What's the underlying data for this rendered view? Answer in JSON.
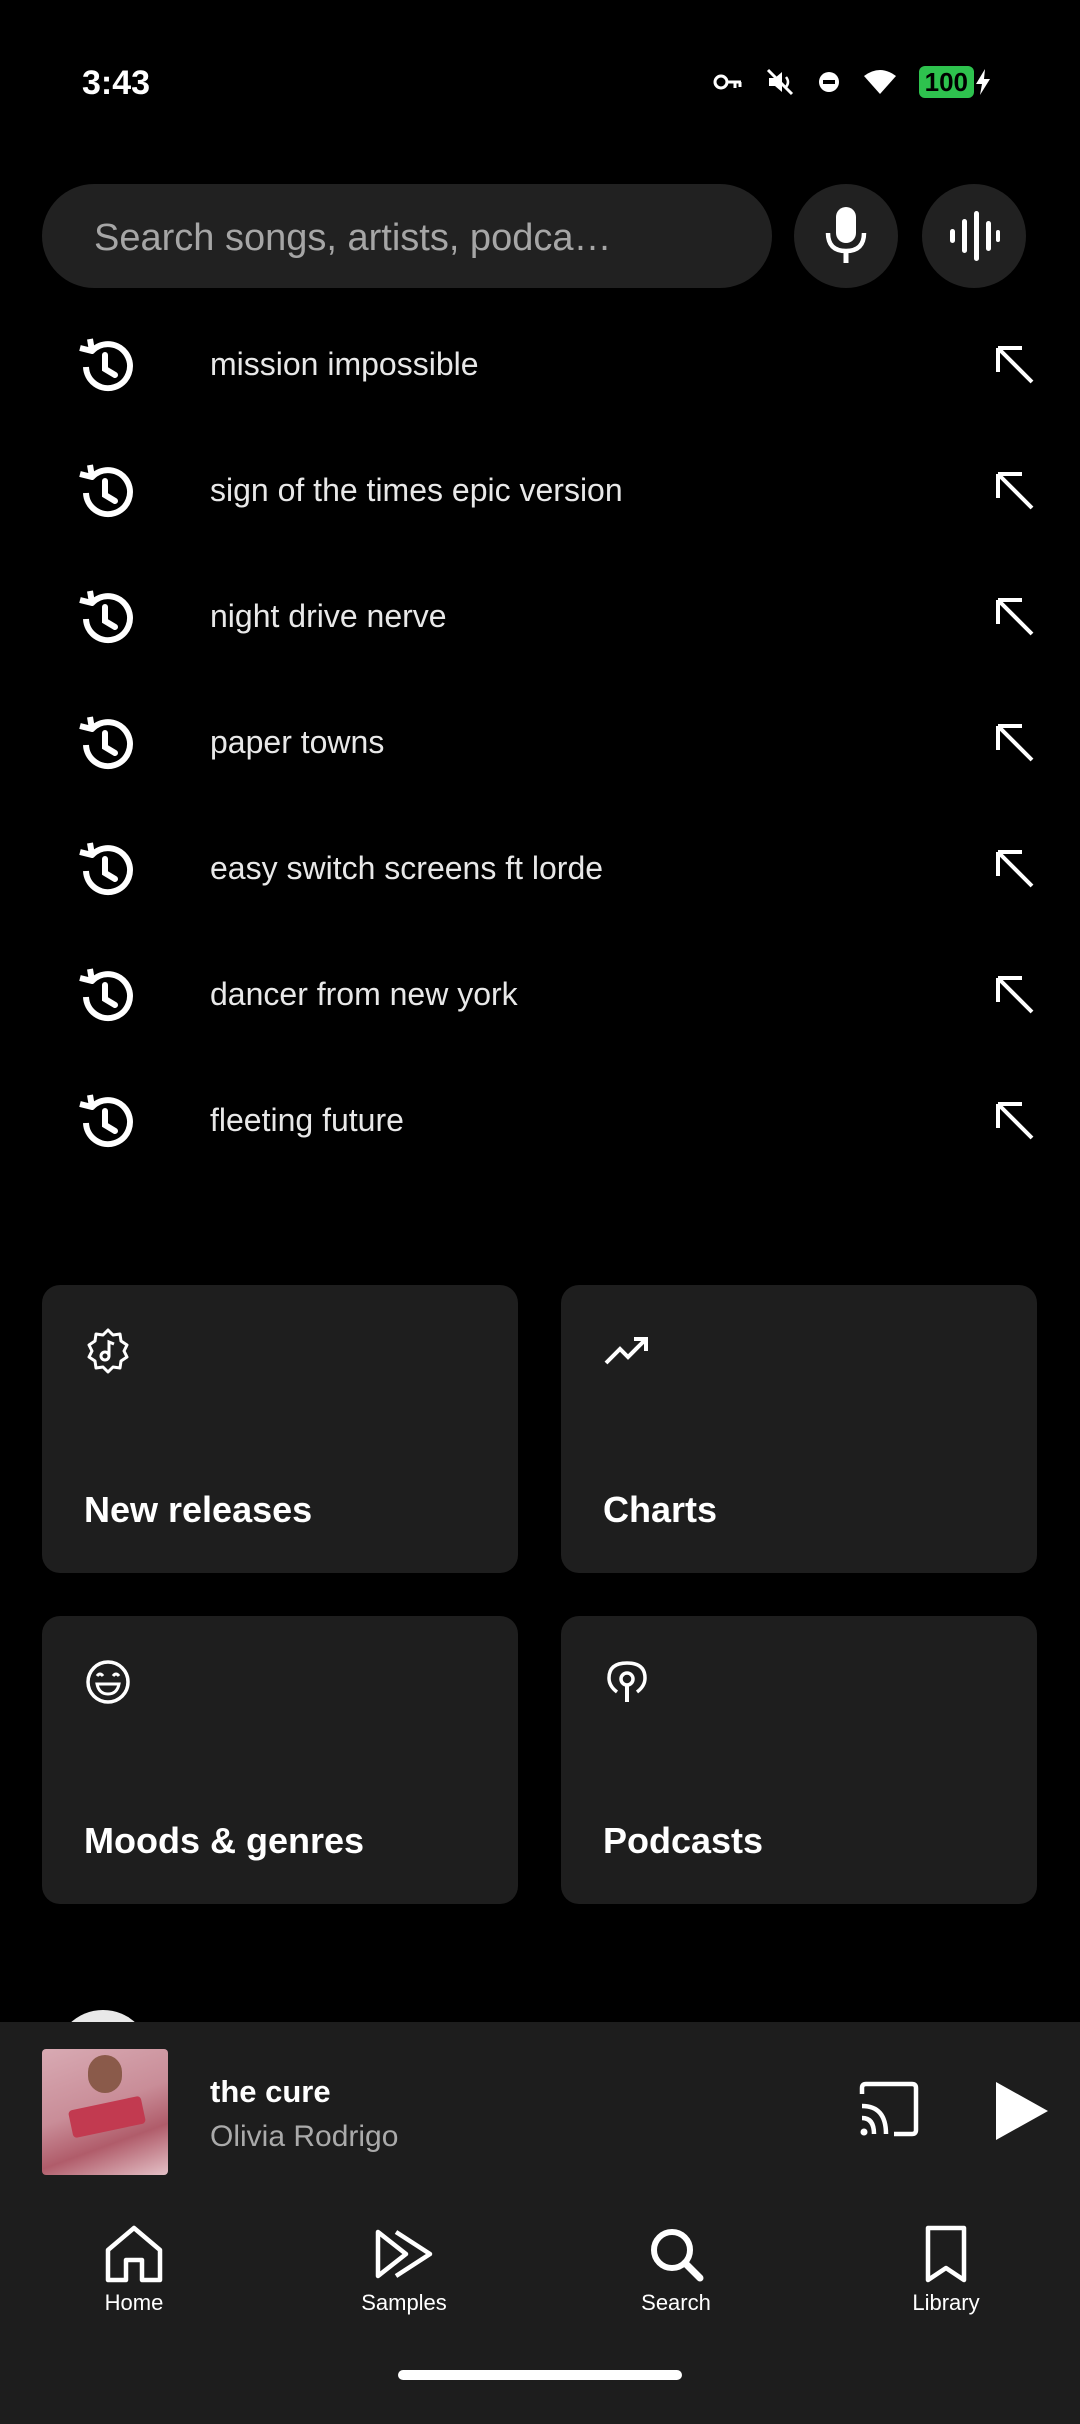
{
  "status_bar": {
    "time": "3:43",
    "battery": "100",
    "icons": [
      "vpn-key-icon",
      "mute-icon",
      "dnd-icon",
      "wifi-icon",
      "battery-icon",
      "charging-icon"
    ]
  },
  "search": {
    "placeholder": "Search songs, artists, podca…",
    "mic_icon": "mic-icon",
    "voice_search_icon": "soundwave-icon"
  },
  "history": [
    {
      "label": "mission impossible"
    },
    {
      "label": "sign of the times epic version"
    },
    {
      "label": "night drive nerve"
    },
    {
      "label": "paper towns"
    },
    {
      "label": "easy switch screens ft lorde"
    },
    {
      "label": "dancer from new york"
    },
    {
      "label": "fleeting future"
    }
  ],
  "categories": [
    {
      "label": "New releases",
      "icon": "new-release-badge-icon"
    },
    {
      "label": "Charts",
      "icon": "trending-up-icon"
    },
    {
      "label": "Moods & genres",
      "icon": "smile-icon"
    },
    {
      "label": "Podcasts",
      "icon": "podcast-icon"
    }
  ],
  "mini_player": {
    "title": "the cure",
    "artist": "Olivia Rodrigo",
    "cast_icon": "cast-icon",
    "play_icon": "play-icon"
  },
  "bottom_nav": [
    {
      "label": "Home",
      "icon": "home-icon"
    },
    {
      "label": "Samples",
      "icon": "samples-icon"
    },
    {
      "label": "Search",
      "icon": "search-icon"
    },
    {
      "label": "Library",
      "icon": "bookmark-icon"
    }
  ],
  "colors": {
    "background": "#000000",
    "surface": "#1e1e1e",
    "battery": "#2ec24e"
  }
}
